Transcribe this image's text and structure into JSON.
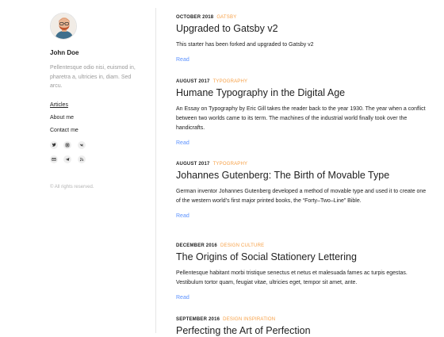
{
  "sidebar": {
    "author_name": "John Doe",
    "author_bio": "Pellentesque odio nisi, euismod in, pharetra a, ultricies in, diam. Sed arcu.",
    "nav": [
      {
        "label": "Articles",
        "active": true
      },
      {
        "label": "About me",
        "active": false
      },
      {
        "label": "Contact me",
        "active": false
      }
    ],
    "social_icons": [
      "twitter-icon",
      "instagram-icon",
      "vk-icon",
      "email-icon",
      "telegram-icon",
      "rss-icon"
    ],
    "copyright": "© All rights reserved."
  },
  "posts": [
    {
      "date": "October 2018",
      "category": "Gatsby",
      "title": "Upgraded to Gatsby v2",
      "excerpt": "This starter has been forked and upgraded to Gatsby v2",
      "read_label": "Read"
    },
    {
      "date": "August 2017",
      "category": "Typography",
      "title": "Humane Typography in the Digital Age",
      "excerpt": "An Essay on Typography by Eric Gill takes the reader back to the year 1930. The year when a conflict between two worlds came to its term. The machines of the industrial world finally took over the handicrafts.",
      "read_label": "Read"
    },
    {
      "date": "August 2017",
      "category": "Typography",
      "title": "Johannes Gutenberg: The Birth of Movable Type",
      "excerpt": "German inventor Johannes Gutenberg developed a method of movable type and used it to create one of the western world’s first major printed books, the “Forty–Two–Line” Bible.",
      "read_label": "Read"
    },
    {
      "date": "December 2016",
      "category": "Design Culture",
      "title": "The Origins of Social Stationery Lettering",
      "excerpt": "Pellentesque habitant morbi tristique senectus et netus et malesuada fames ac turpis egestas. Vestibulum tortor quam, feugiat vitae, ultricies eget, tempor sit amet, ante.",
      "read_label": "Read"
    },
    {
      "date": "September 2016",
      "category": "Design Inspiration",
      "title": "Perfecting the Art of Perfection",
      "excerpt": "",
      "read_label": ""
    }
  ]
}
